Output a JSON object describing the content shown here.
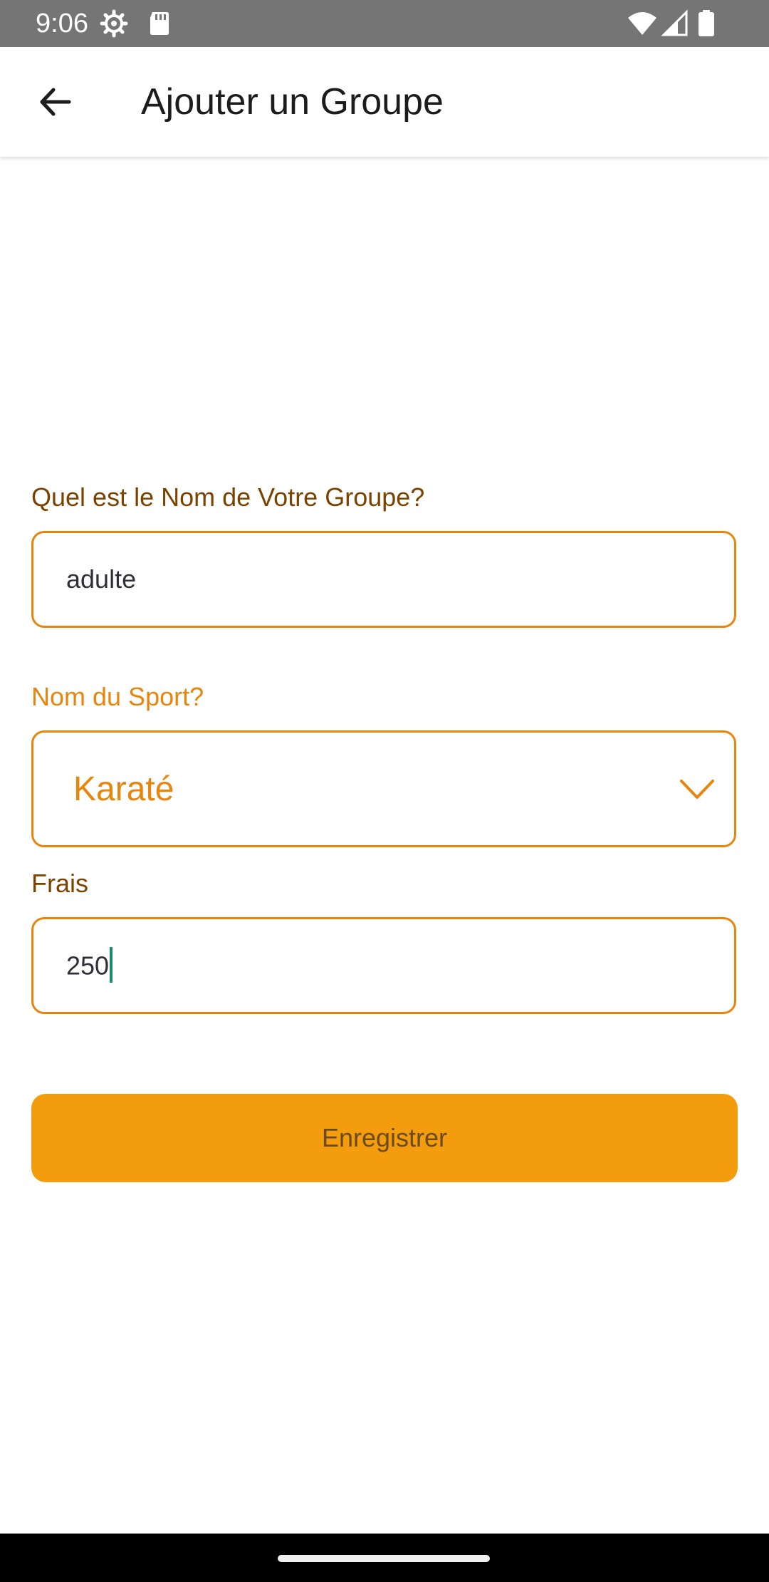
{
  "status_bar": {
    "time": "9:06",
    "left_icons": [
      "settings-gear-icon",
      "sd-card-icon"
    ],
    "right_icons": [
      "wifi-icon",
      "cell-signal-icon",
      "battery-icon"
    ]
  },
  "app_bar": {
    "back_icon": "arrow-back-icon",
    "title": "Ajouter un Groupe"
  },
  "form": {
    "group_name": {
      "label": "Quel est le Nom de Votre Groupe?",
      "value": "adulte"
    },
    "sport": {
      "label": "Nom du Sport?",
      "selected": "Karaté",
      "icon": "chevron-down-icon"
    },
    "fee": {
      "label": "Frais",
      "value": "250"
    },
    "save_label": "Enregistrer"
  },
  "colors": {
    "accent": "#e8850c",
    "button": "#f39c0e",
    "label_dark": "#7a4300",
    "status_bar": "#757575",
    "caret": "#1d8a6e"
  }
}
